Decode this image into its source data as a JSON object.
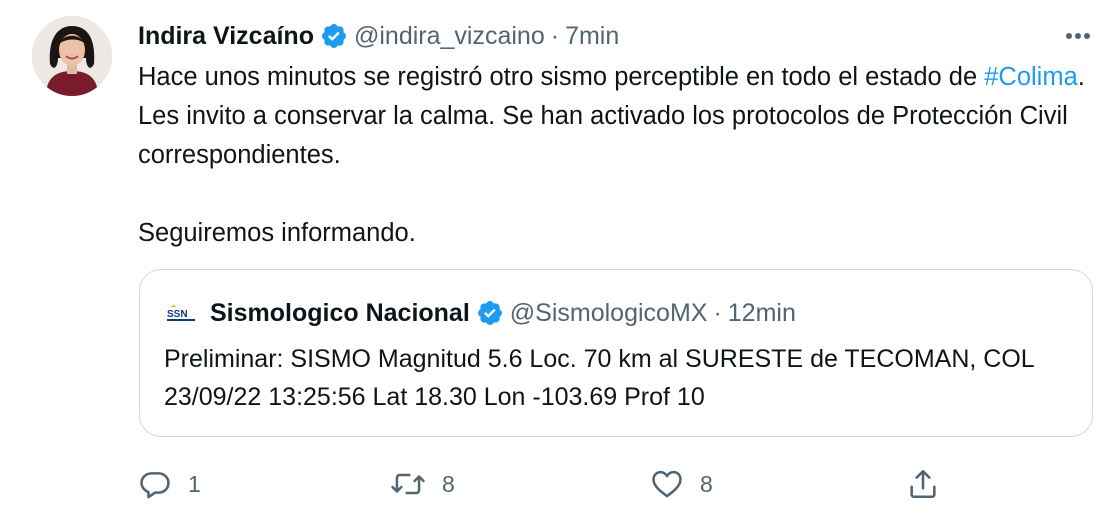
{
  "tweet": {
    "author": {
      "display_name": "Indira Vizcaíno",
      "handle": "@indira_vizcaino",
      "verified": true
    },
    "separator": "·",
    "time": "7min",
    "text": {
      "line1_prefix": "Hace unos minutos se registró otro sismo perceptible en todo el estado de",
      "hashtag": "#Colima",
      "line1_suffix": ". Les invito a conservar la calma. Se han activado los protocolos de Protección Civil correspondientes.",
      "line2": "Seguiremos informando."
    },
    "more_icon": "more-horizontal-icon"
  },
  "quoted_tweet": {
    "author": {
      "logo_text": "SSN",
      "display_name": "Sismologico Nacional",
      "handle": "@SismologicoMX",
      "verified": true
    },
    "separator": "·",
    "time": "12min",
    "text": "Preliminar: SISMO Magnitud 5.6 Loc. 70 km al SURESTE de TECOMAN, COL 23/09/22 13:25:56 Lat 18.30 Lon -103.69 Prof 10"
  },
  "actions": {
    "reply": {
      "icon": "reply-icon",
      "count": "1"
    },
    "retweet": {
      "icon": "retweet-icon",
      "count": "8"
    },
    "like": {
      "icon": "heart-icon",
      "count": "8"
    },
    "share": {
      "icon": "share-icon"
    }
  },
  "colors": {
    "link": "#1d9bf0",
    "verified": "#1d9bf0",
    "secondary_text": "#536471",
    "border": "#cfd9de"
  }
}
